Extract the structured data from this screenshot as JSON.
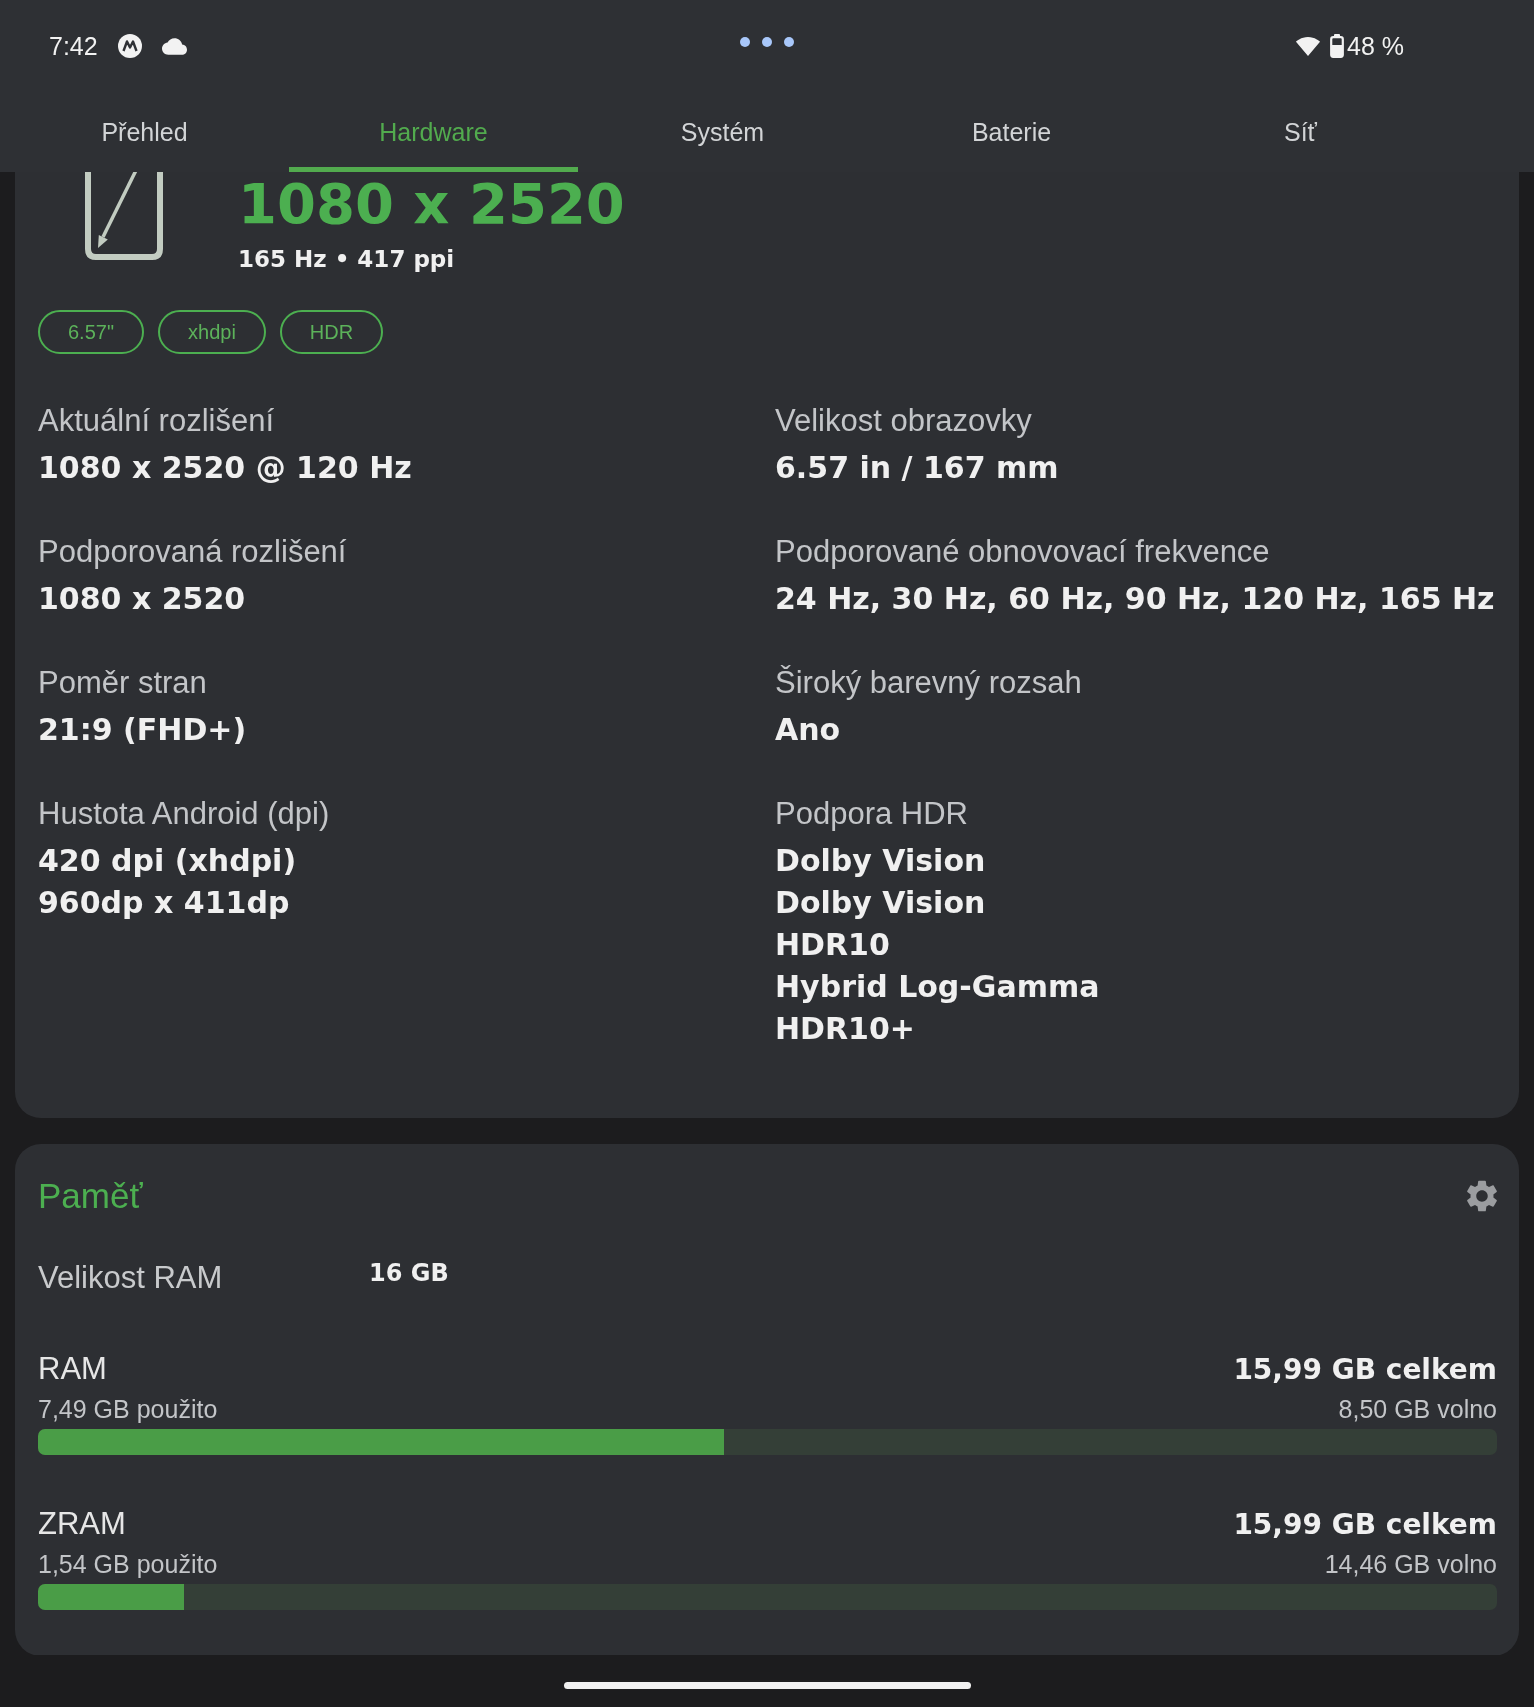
{
  "status_bar": {
    "time": "7:42",
    "battery": "48 %"
  },
  "tabs": [
    {
      "label": "Přehled",
      "selected": false
    },
    {
      "label": "Hardware",
      "selected": true
    },
    {
      "label": "Systém",
      "selected": false
    },
    {
      "label": "Baterie",
      "selected": false
    },
    {
      "label": "Síť",
      "selected": false
    }
  ],
  "display": {
    "resolution": "1080 x 2520",
    "subtitle": "165 Hz • 417 ppi",
    "chips": [
      "6.57\"",
      "xhdpi",
      "HDR"
    ],
    "specs": [
      {
        "label": "Aktuální rozlišení",
        "values": [
          "1080 x 2520 @ 120 Hz"
        ]
      },
      {
        "label": "Velikost obrazovky",
        "values": [
          "6.57 in / 167 mm"
        ]
      },
      {
        "label": "Podporovaná rozlišení",
        "values": [
          "1080 x 2520"
        ]
      },
      {
        "label": "Podporované obnovovací frekvence",
        "values": [
          "24 Hz, 30 Hz, 60 Hz, 90 Hz, 120 Hz, 165 Hz"
        ]
      },
      {
        "label": "Poměr stran",
        "values": [
          "21:9 (FHD+)"
        ]
      },
      {
        "label": "Široký barevný rozsah",
        "values": [
          "Ano"
        ]
      },
      {
        "label": "Hustota Android (dpi)",
        "values": [
          "420 dpi (xhdpi)",
          "960dp x 411dp"
        ]
      },
      {
        "label": "Podpora HDR",
        "values": [
          "Dolby Vision",
          "Dolby Vision",
          "HDR10",
          "Hybrid Log-Gamma",
          "HDR10+"
        ]
      }
    ]
  },
  "memory": {
    "title": "Paměť",
    "ram_size": {
      "label": "Velikost RAM",
      "value": "16 GB"
    },
    "meters": [
      {
        "name": "RAM",
        "total": "15,99 GB celkem",
        "used": "7,49 GB použito",
        "free": "8,50 GB volno",
        "level": 0.47
      },
      {
        "name": "ZRAM",
        "total": "15,99 GB celkem",
        "used": "1,54 GB použito",
        "free": "14,46 GB volno",
        "level": 0.1
      }
    ]
  }
}
